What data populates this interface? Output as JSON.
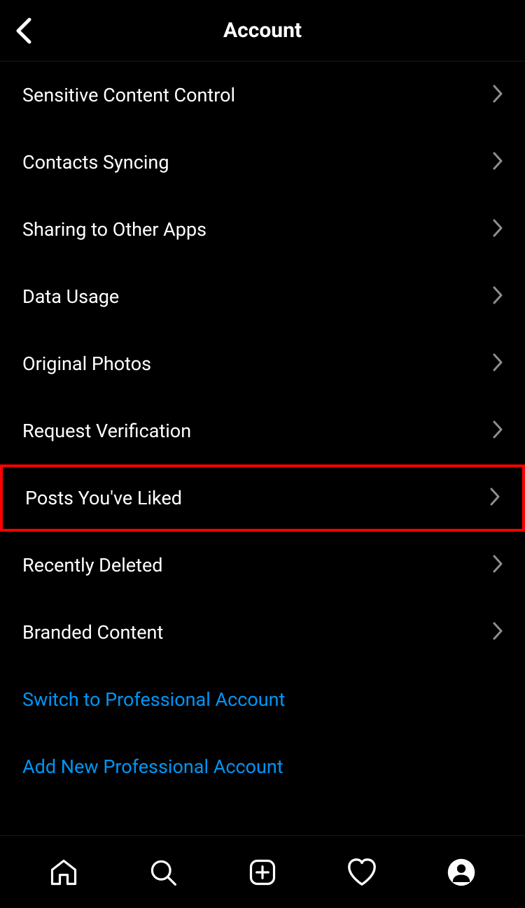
{
  "header": {
    "title": "Account"
  },
  "menu": {
    "items": [
      {
        "label": "Sensitive Content Control"
      },
      {
        "label": "Contacts Syncing"
      },
      {
        "label": "Sharing to Other Apps"
      },
      {
        "label": "Data Usage"
      },
      {
        "label": "Original Photos"
      },
      {
        "label": "Request Verification"
      },
      {
        "label": "Posts You've Liked"
      },
      {
        "label": "Recently Deleted"
      },
      {
        "label": "Branded Content"
      }
    ],
    "links": [
      {
        "label": "Switch to Professional Account"
      },
      {
        "label": "Add New Professional Account"
      }
    ]
  }
}
